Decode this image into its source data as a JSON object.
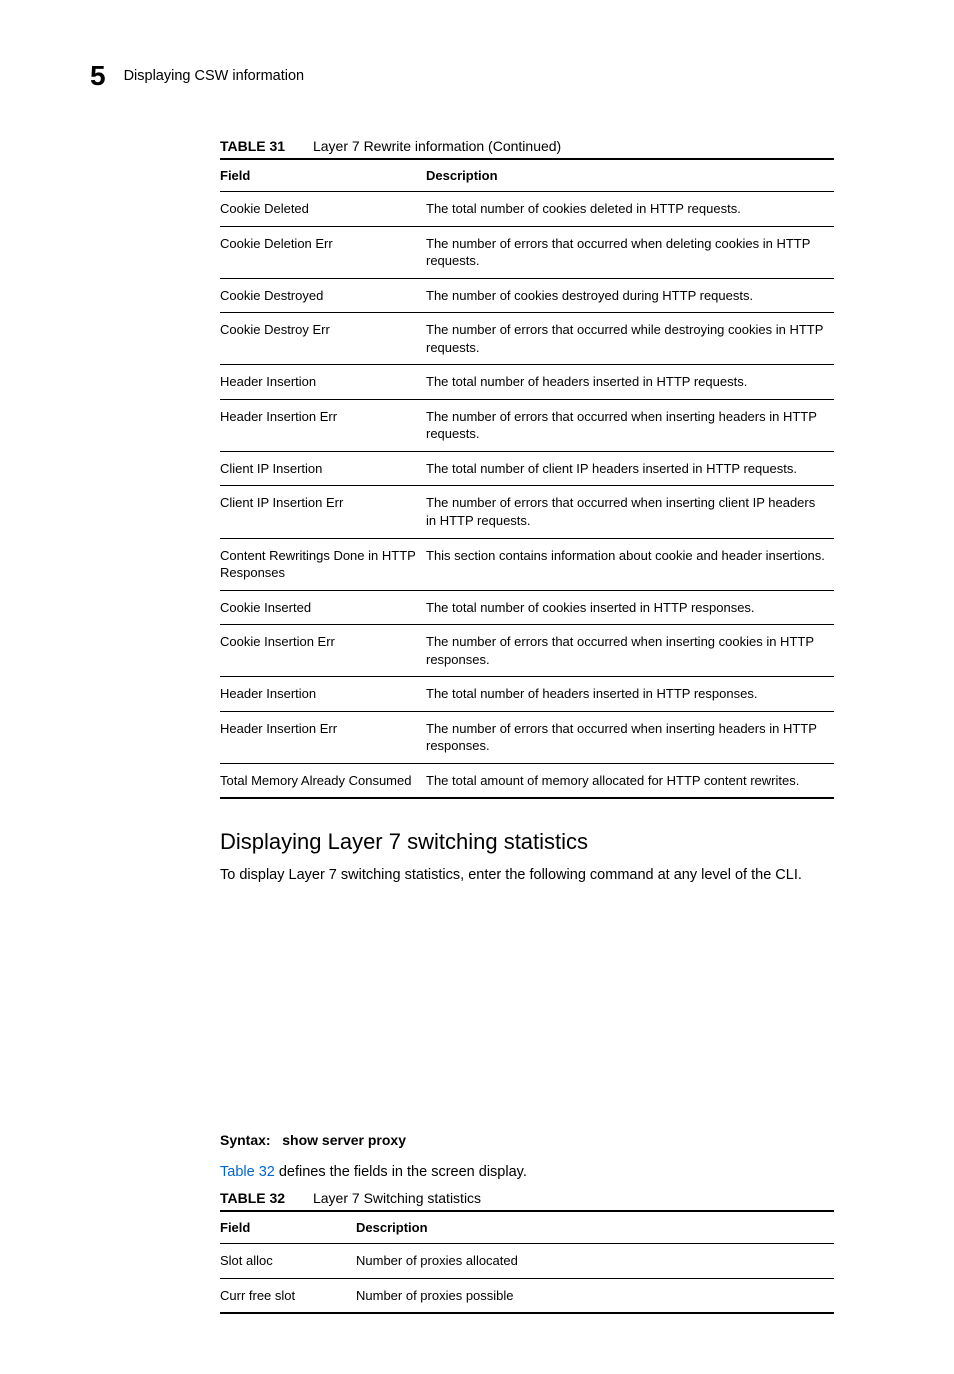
{
  "header": {
    "chapter_number": "5",
    "running_title": "Displaying CSW information"
  },
  "table31": {
    "caption_num": "TABLE 31",
    "caption_text": "Layer 7 Rewrite information (Continued)",
    "head_field": "Field",
    "head_desc": "Description",
    "rows": [
      {
        "field": "Cookie Deleted",
        "desc": "The total number of cookies deleted in HTTP requests."
      },
      {
        "field": "Cookie Deletion Err",
        "desc": "The number of errors that occurred when deleting cookies in HTTP requests."
      },
      {
        "field": "Cookie Destroyed",
        "desc": "The number of cookies destroyed during HTTP requests."
      },
      {
        "field": "Cookie Destroy Err",
        "desc": "The number of errors that occurred while destroying cookies in HTTP requests."
      },
      {
        "field": "Header Insertion",
        "desc": "The total number of headers inserted in HTTP requests."
      },
      {
        "field": "Header Insertion Err",
        "desc": "The number of errors that occurred when inserting headers in HTTP requests."
      },
      {
        "field": "Client IP Insertion",
        "desc": "The total number of client IP headers inserted in HTTP requests."
      },
      {
        "field": "Client IP Insertion Err",
        "desc": "The number of errors that occurred when inserting client IP headers in HTTP requests."
      },
      {
        "field": "Content Rewritings Done in HTTP Responses",
        "desc": "This section contains information about cookie and header insertions."
      },
      {
        "field": "Cookie Inserted",
        "desc": "The total number of cookies inserted in HTTP responses."
      },
      {
        "field": "Cookie Insertion Err",
        "desc": "The number of errors that occurred when inserting cookies in HTTP responses."
      },
      {
        "field": "Header Insertion",
        "desc": "The total number of headers inserted in HTTP responses."
      },
      {
        "field": "Header Insertion Err",
        "desc": "The number of errors that occurred when inserting headers in HTTP responses."
      },
      {
        "field": "Total Memory Already Consumed",
        "desc": "The total amount of memory allocated for HTTP content rewrites."
      }
    ]
  },
  "section": {
    "heading": "Displaying Layer 7 switching statistics",
    "intro": "To display Layer 7 switching statistics, enter the following command at any level of the CLI.",
    "syntax_label": "Syntax:",
    "syntax_cmd": "show server proxy",
    "crossref": "Table 32",
    "crossref_after": " defines the fields in the screen display."
  },
  "table32": {
    "caption_num": "TABLE 32",
    "caption_text": "Layer 7 Switching statistics",
    "head_field": "Field",
    "head_desc": "Description",
    "rows": [
      {
        "field": "Slot alloc",
        "desc": "Number of proxies allocated"
      },
      {
        "field": "Curr free slot",
        "desc": "Number of proxies possible"
      }
    ]
  }
}
